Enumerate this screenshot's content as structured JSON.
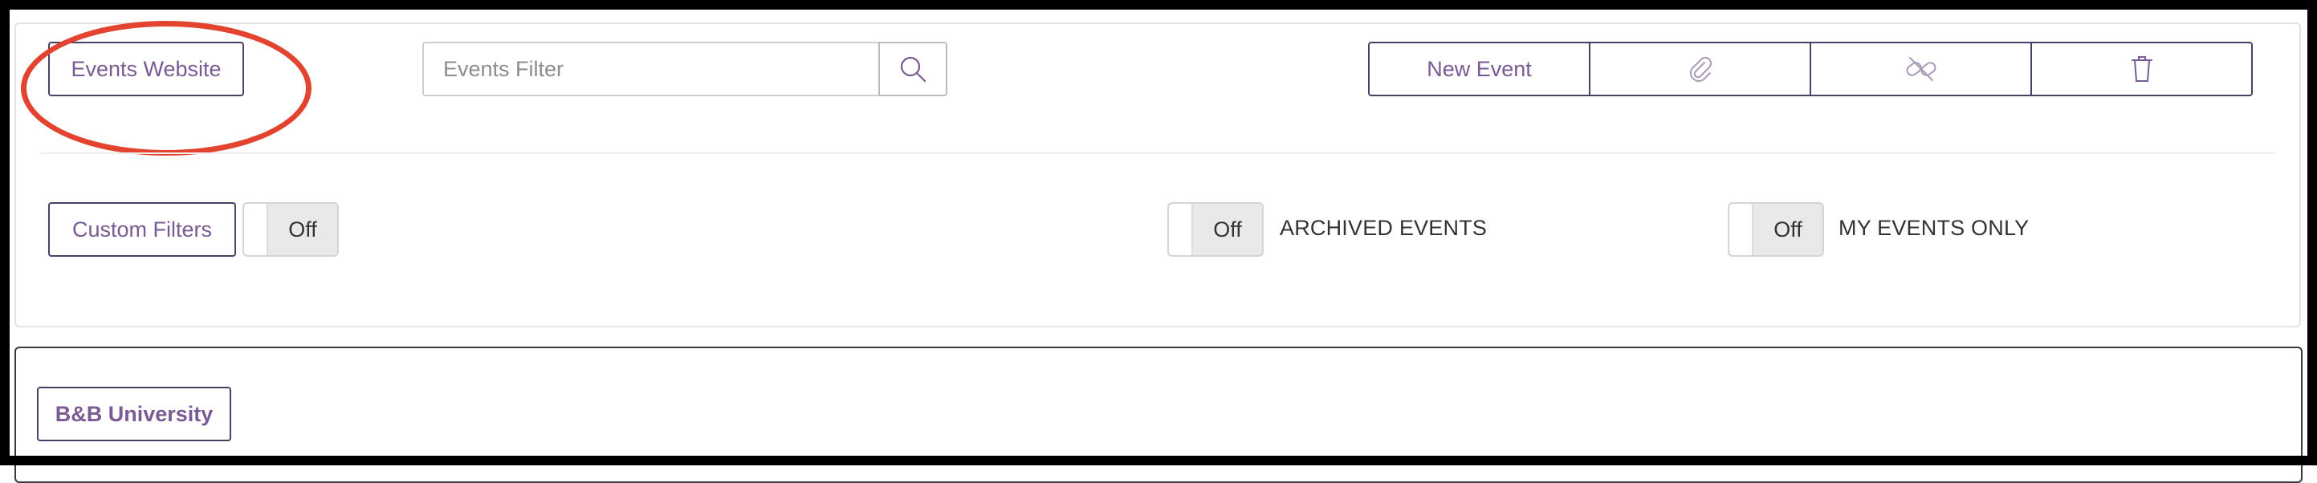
{
  "toolbar": {
    "events_website_label": "Events Website",
    "search": {
      "placeholder": "Events Filter",
      "value": ""
    },
    "new_event_label": "New Event",
    "icons": [
      "search-icon",
      "paperclip-icon",
      "unlink-icon",
      "trash-icon"
    ]
  },
  "filters": {
    "custom_filters_label": "Custom Filters",
    "custom_filters_state": "Off",
    "archived_state": "Off",
    "archived_label": "ARCHIVED EVENTS",
    "my_events_state": "Off",
    "my_events_label": "MY EVENTS ONLY"
  },
  "groups": {
    "first_group_label": "B&B University"
  },
  "colors": {
    "accent_text": "#7a5a93",
    "button_border": "#4d3f63",
    "annotation": "#e2442f"
  }
}
